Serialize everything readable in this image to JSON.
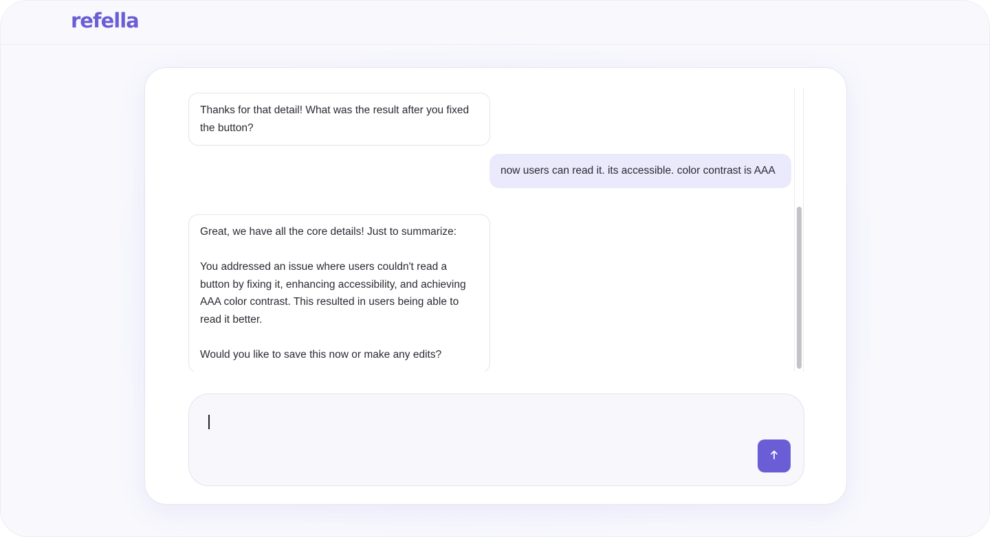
{
  "brand": {
    "logo_text": "refella",
    "accent_color": "#6a5dd6"
  },
  "messages": [
    {
      "role": "assistant",
      "text": "Thanks for that detail! What was the result after you fixed the button?"
    },
    {
      "role": "user",
      "text": "now users can read it. its accessible. color contrast is AAA"
    },
    {
      "role": "assistant",
      "text": "Great, we have all the core details! Just to summarize:\n\nYou addressed an issue where users couldn't read a button by fixing it, enhancing accessibility, and achieving AAA color contrast. This resulted in users being able to read it better.\n\nWould you like to save this now or make any edits?"
    }
  ],
  "composer": {
    "value": "",
    "placeholder": "",
    "send_icon": "arrow-up-icon"
  }
}
